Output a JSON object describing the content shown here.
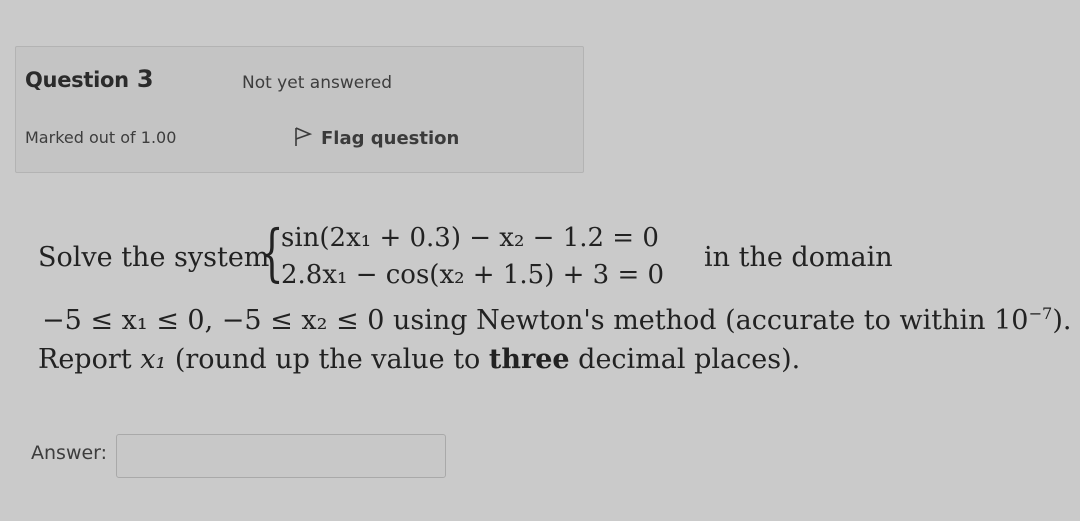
{
  "question": {
    "label": "Question",
    "number": "3",
    "state": "Not yet answered",
    "grade": "Marked out of 1.00",
    "flag_label": "Flag question"
  },
  "text": {
    "solve_prefix": "Solve the system",
    "equation_1": "sin(2x₁ + 0.3) − x₂ − 1.2 = 0",
    "equation_2": "2.8x₁ − cos(x₂ + 1.5) + 3 = 0",
    "domain_suffix": "in the domain",
    "domain_constraint": "−5 ≤ x₁ ≤ 0, −5 ≤ x₂ ≤ 0",
    "method_text": "using Newton's method (accurate to within 10",
    "exponent": "−7",
    "method_end": ").",
    "report_prefix": "Report",
    "report_var": "x₁",
    "report_mid": "(round up the value to",
    "report_bold": "three",
    "report_end": "decimal places)."
  },
  "answer": {
    "label": "Answer:",
    "value": ""
  }
}
